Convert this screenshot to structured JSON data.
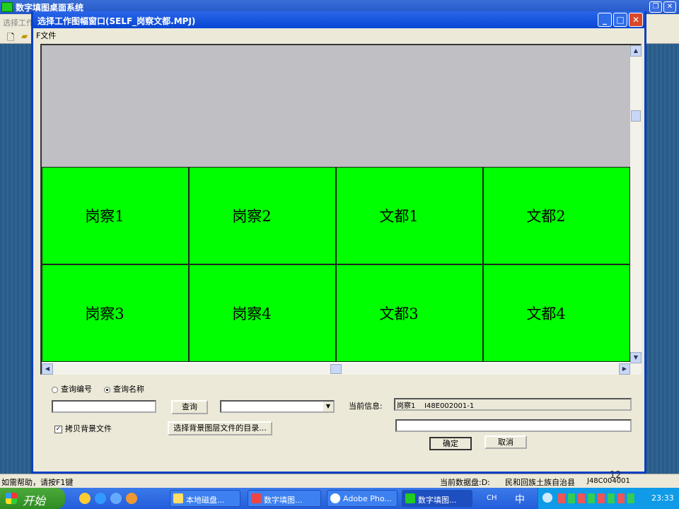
{
  "app": {
    "title": "数字填图桌面系统",
    "menu_first": "选择工作"
  },
  "dialog": {
    "title": "选择工作图幅窗口(SELF_岗察文都.MPJ)",
    "menu": [
      {
        "label": "F文件"
      }
    ],
    "tiles": [
      {
        "label": "岗察1"
      },
      {
        "label": "岗察2"
      },
      {
        "label": "文都1"
      },
      {
        "label": "文都2"
      },
      {
        "label": "岗察3"
      },
      {
        "label": "岗察4"
      },
      {
        "label": "文都3"
      },
      {
        "label": "文都4"
      }
    ],
    "radio_by_number": "查询编号",
    "radio_by_name": "查询名称",
    "selected_radio": "查询名称",
    "search_input_value": "",
    "query_button": "查询",
    "dropdown_value": "",
    "copy_bg_checkbox": "拷贝背景文件",
    "copy_bg_checked": true,
    "select_dir_button": "选择背景图层文件的目录...",
    "current_info_label": "当前信息:",
    "current_info_value": "岗察1    I48E002001-1",
    "path_value": "",
    "ok_button": "确定",
    "cancel_button": "取消"
  },
  "status": {
    "help": "如需帮助，请按F1键",
    "disk": "当前数据盘:D:",
    "county": "民和回族土族自治县",
    "code": "J48C004001",
    "page": "12"
  },
  "taskbar": {
    "start": "开始",
    "items": [
      {
        "label": "本地磁盘..."
      },
      {
        "label": "数字填图..."
      },
      {
        "label": "Adobe Pho..."
      },
      {
        "label": "数字填图..."
      }
    ],
    "lang": "CH",
    "ime": "中",
    "clock": "23:33"
  },
  "colors": {
    "tile": "#00ff00",
    "gray": "#c0bfc4",
    "titlebar": "#0846d4"
  }
}
